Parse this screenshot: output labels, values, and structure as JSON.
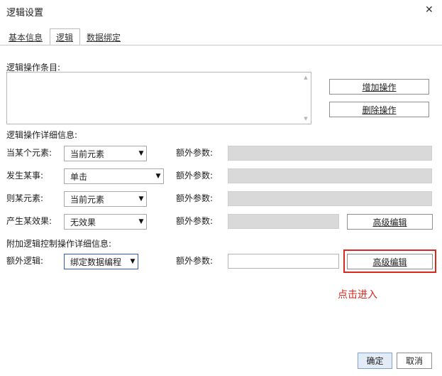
{
  "dialog": {
    "title": "逻辑设置",
    "close_glyph": "✕"
  },
  "tabs": [
    {
      "label": "基本信息"
    },
    {
      "label": "逻辑"
    },
    {
      "label": "数据绑定"
    }
  ],
  "ops": {
    "list_label": "逻辑操作条目:",
    "add_label": "增加操作",
    "delete_label": "删除操作",
    "scroll_up": "▲",
    "scroll_down": "▼"
  },
  "detail": {
    "heading": "逻辑操作详细信息:",
    "rows": [
      {
        "label": "当某个元素:",
        "value": "当前元素",
        "param_label": "额外参数:"
      },
      {
        "label": "发生某事:",
        "value": "单击",
        "param_label": "额外参数:"
      },
      {
        "label": "则某元素:",
        "value": "当前元素",
        "param_label": "额外参数:"
      },
      {
        "label": "产生某效果:",
        "value": "无效果",
        "param_label": "额外参数:",
        "advanced_label": "高级编辑"
      }
    ]
  },
  "extra": {
    "heading": "附加逻辑控制操作详细信息:",
    "label": "额外逻辑:",
    "value": "绑定数据编程",
    "param_label": "额外参数:",
    "advanced_label": "高级编辑"
  },
  "annotation": {
    "text": "点击进入",
    "color": "#d9281e"
  },
  "footer": {
    "ok_label": "确定",
    "cancel_label": "取消"
  },
  "icons": {
    "dropdown_arrow": "▼",
    "dropdown_icon": "chevron-down-icon"
  },
  "colors": {
    "accent": "#2a5fb5",
    "highlight": "#d9281e",
    "disabled_field": "#d9d9d9"
  }
}
